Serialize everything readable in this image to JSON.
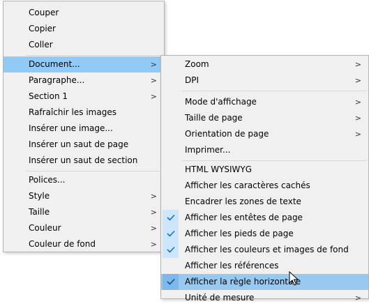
{
  "main_menu": {
    "items": [
      {
        "label": "Couper"
      },
      {
        "label": "Copier"
      },
      {
        "label": "Coller"
      },
      {
        "label": "Document...",
        "arrow": ">"
      },
      {
        "label": "Paragraphe...",
        "arrow": ">"
      },
      {
        "label": "Section 1",
        "arrow": ">"
      },
      {
        "label": "Rafraîchir les images"
      },
      {
        "label": "Insérer une image..."
      },
      {
        "label": "Insérer un saut de page"
      },
      {
        "label": "Insérer un saut de section"
      },
      {
        "label": "Polices..."
      },
      {
        "label": "Style",
        "arrow": ">"
      },
      {
        "label": "Taille",
        "arrow": ">"
      },
      {
        "label": "Couleur",
        "arrow": ">"
      },
      {
        "label": "Couleur de fond",
        "arrow": ">"
      }
    ]
  },
  "document_submenu": {
    "items": [
      {
        "label": "Zoom",
        "arrow": ">"
      },
      {
        "label": "DPI",
        "arrow": ">"
      },
      {
        "label": "Mode d'affichage",
        "arrow": ">"
      },
      {
        "label": "Taille de page",
        "arrow": ">"
      },
      {
        "label": "Orientation de page",
        "arrow": ">"
      },
      {
        "label": "Imprimer..."
      },
      {
        "label": "HTML WYSIWYG"
      },
      {
        "label": "Afficher les caractères cachés"
      },
      {
        "label": "Encadrer les zones de texte"
      },
      {
        "label": "Afficher les entêtes de page",
        "checked": true
      },
      {
        "label": "Afficher les pieds de page",
        "checked": true
      },
      {
        "label": "Afficher les couleurs et images de fond",
        "checked": true
      },
      {
        "label": "Afficher les références"
      },
      {
        "label": "Afficher la règle horizontale",
        "checked": true,
        "hovered": true
      },
      {
        "label": "Unité de mesure",
        "arrow": ">"
      }
    ]
  },
  "colors": {
    "menu_bg": "#f0f0f0",
    "highlight": "#91c9f7",
    "check_bg": "#cde6fb",
    "check_mark": "#1a6fc0"
  }
}
